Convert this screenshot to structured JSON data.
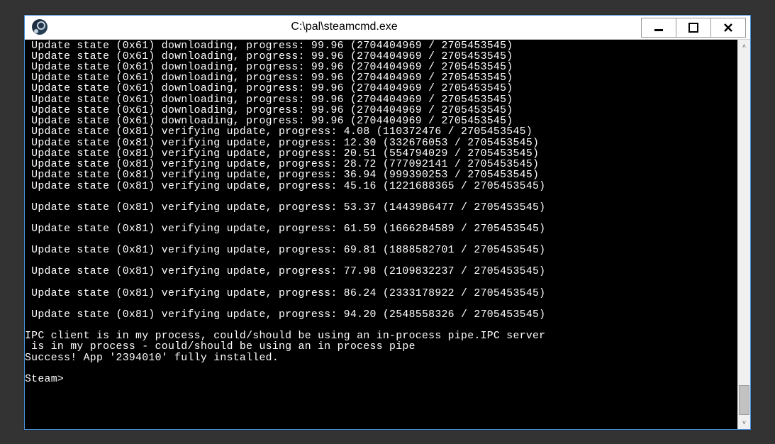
{
  "window": {
    "title": "C:\\pal\\steamcmd.exe"
  },
  "controls": {
    "minimize": "—",
    "maximize": "☐",
    "close": "✕"
  },
  "terminal": {
    "lines": [
      " Update state (0x61) downloading, progress: 99.96 (2704404969 / 2705453545)",
      " Update state (0x61) downloading, progress: 99.96 (2704404969 / 2705453545)",
      " Update state (0x61) downloading, progress: 99.96 (2704404969 / 2705453545)",
      " Update state (0x61) downloading, progress: 99.96 (2704404969 / 2705453545)",
      " Update state (0x61) downloading, progress: 99.96 (2704404969 / 2705453545)",
      " Update state (0x61) downloading, progress: 99.96 (2704404969 / 2705453545)",
      " Update state (0x61) downloading, progress: 99.96 (2704404969 / 2705453545)",
      " Update state (0x61) downloading, progress: 99.96 (2704404969 / 2705453545)",
      " Update state (0x81) verifying update, progress: 4.08 (110372476 / 2705453545)",
      " Update state (0x81) verifying update, progress: 12.30 (332676053 / 2705453545)",
      " Update state (0x81) verifying update, progress: 20.51 (554794029 / 2705453545)",
      " Update state (0x81) verifying update, progress: 28.72 (777092141 / 2705453545)",
      " Update state (0x81) verifying update, progress: 36.94 (999390253 / 2705453545)",
      " Update state (0x81) verifying update, progress: 45.16 (1221688365 / 2705453545)",
      "",
      " Update state (0x81) verifying update, progress: 53.37 (1443986477 / 2705453545)",
      "",
      " Update state (0x81) verifying update, progress: 61.59 (1666284589 / 2705453545)",
      "",
      " Update state (0x81) verifying update, progress: 69.81 (1888582701 / 2705453545)",
      "",
      " Update state (0x81) verifying update, progress: 77.98 (2109832237 / 2705453545)",
      "",
      " Update state (0x81) verifying update, progress: 86.24 (2333178922 / 2705453545)",
      "",
      " Update state (0x81) verifying update, progress: 94.20 (2548558326 / 2705453545)",
      "",
      "IPC client is in my process, could/should be using an in-process pipe.IPC server",
      " is in my process - could/should be using an in process pipe",
      "Success! App '2394010' fully installed.",
      "",
      "Steam>"
    ]
  },
  "scroll": {
    "up": "˄",
    "down": "˅"
  }
}
